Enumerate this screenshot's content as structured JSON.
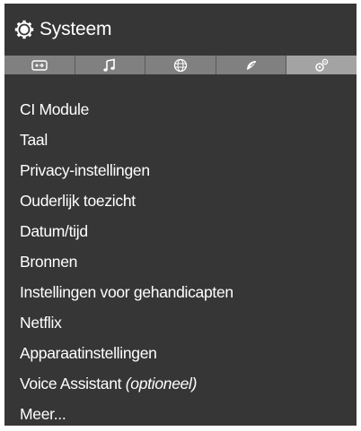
{
  "header": {
    "title": "Systeem",
    "icon": "gear-icon"
  },
  "tabs": [
    {
      "name": "picture",
      "icon": "picture-icon",
      "active": false
    },
    {
      "name": "sound",
      "icon": "music-note-icon",
      "active": false
    },
    {
      "name": "network",
      "icon": "globe-icon",
      "active": false
    },
    {
      "name": "installation",
      "icon": "satellite-dish-icon",
      "active": false
    },
    {
      "name": "system",
      "icon": "gears-icon",
      "active": true
    }
  ],
  "menu": {
    "items": [
      {
        "label": "CI Module",
        "suffix": ""
      },
      {
        "label": "Taal",
        "suffix": ""
      },
      {
        "label": "Privacy-instellingen",
        "suffix": ""
      },
      {
        "label": "Ouderlijk toezicht",
        "suffix": ""
      },
      {
        "label": "Datum/tijd",
        "suffix": ""
      },
      {
        "label": "Bronnen",
        "suffix": ""
      },
      {
        "label": "Instellingen voor gehandicapten",
        "suffix": ""
      },
      {
        "label": "Netflix",
        "suffix": ""
      },
      {
        "label": "Apparaatinstellingen",
        "suffix": ""
      },
      {
        "label": "Voice Assistant ",
        "suffix": "(optioneel)"
      },
      {
        "label": "Meer...",
        "suffix": ""
      }
    ]
  },
  "colors": {
    "panel_background": "#363636",
    "tab_background": "#808080",
    "tab_active_background": "#a3a3a3",
    "text": "#ffffff"
  }
}
